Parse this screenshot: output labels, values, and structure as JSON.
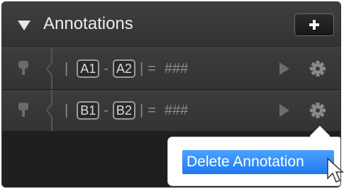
{
  "header": {
    "title": "Annotations",
    "add_icon": "plus-icon"
  },
  "rows": [
    {
      "start_cell": "A1",
      "end_cell": "A2",
      "separator": "-",
      "equals": "=",
      "result": "###",
      "pipe": "|"
    },
    {
      "start_cell": "B1",
      "end_cell": "B2",
      "separator": "-",
      "equals": "=",
      "result": "###",
      "pipe": "|"
    }
  ],
  "popup": {
    "delete_label": "Delete Annotation"
  },
  "colors": {
    "panel_bg": "#1f1f1f",
    "row_bg": "#3c3c3c",
    "button_blue": "#1f78f0"
  }
}
